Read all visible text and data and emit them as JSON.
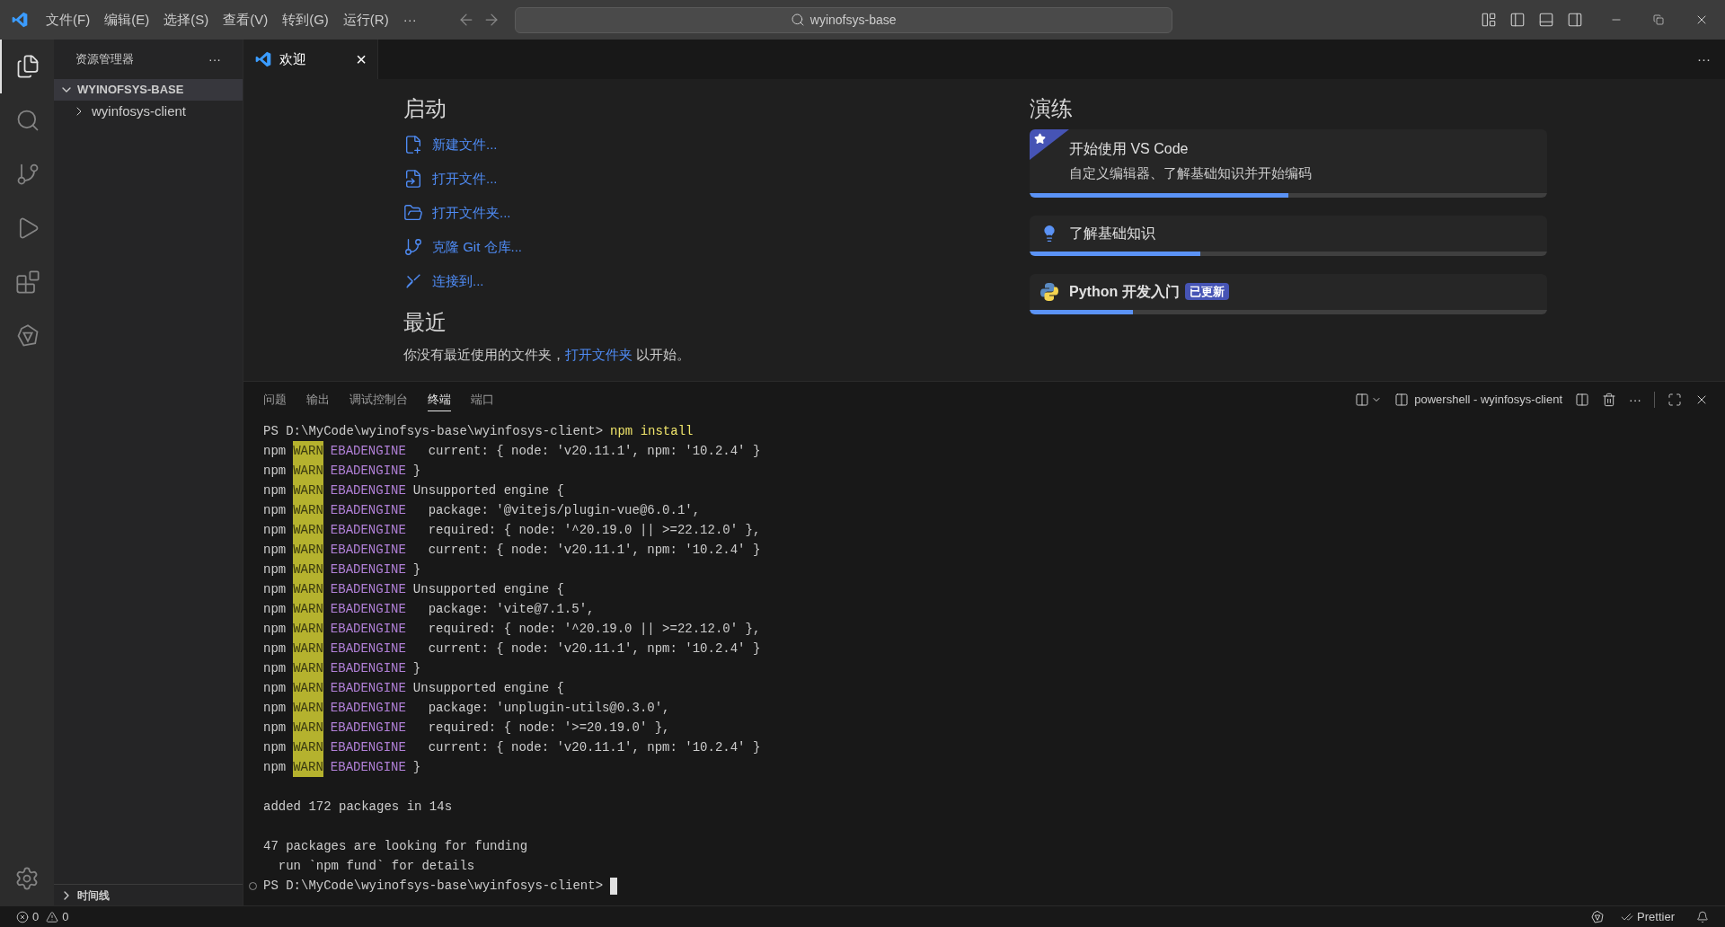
{
  "title_bar": {
    "menus": [
      "文件(F)",
      "编辑(E)",
      "选择(S)",
      "查看(V)",
      "转到(G)",
      "运行(R)",
      "···"
    ],
    "search": "wyinofsys-base"
  },
  "activity_bar": [
    {
      "kind": "files",
      "selected": true
    },
    {
      "kind": "search",
      "selected": false
    },
    {
      "kind": "git",
      "selected": false
    },
    {
      "kind": "debug",
      "selected": false
    },
    {
      "kind": "extensions",
      "selected": false
    },
    {
      "kind": "remote",
      "selected": false
    }
  ],
  "sidebar": {
    "title": "资源管理器",
    "more": "···",
    "folder": {
      "name": "WYINOFSYS-BASE",
      "expanded": true,
      "children": [
        {
          "name": "wyinfosys-client",
          "expanded": false
        }
      ]
    },
    "timeline": {
      "name": "时间线",
      "expanded": false
    }
  },
  "editor_tabs": [
    {
      "label": "欢迎",
      "selected": true,
      "close": "×"
    }
  ],
  "editor_more": "···",
  "welcome": {
    "start_title": "启动",
    "start_items": [
      {
        "kind": "new-file",
        "label": "新建文件..."
      },
      {
        "kind": "open-file",
        "label": "打开文件..."
      },
      {
        "kind": "open-folder",
        "label": "打开文件夹..."
      },
      {
        "kind": "clone",
        "label": "克隆 Git 仓库..."
      },
      {
        "kind": "connect",
        "label": "连接到..."
      }
    ],
    "recent_title": "最近",
    "recent_before": "你没有最近使用的文件夹，",
    "recent_link": "打开文件夹",
    "recent_after": "以开始。",
    "walkthrough_title": "演练",
    "walkthroughs": [
      {
        "kind": "featured",
        "title": "开始使用 VS Code",
        "description": "自定义编辑器、了解基础知识并开始编码",
        "level": 0.5
      },
      {
        "kind": "lightbulb",
        "title": "了解基础知识",
        "level": 0.33
      },
      {
        "kind": "python",
        "title": "Python 开发入门",
        "badge": "已更新",
        "level": 0.2
      }
    ]
  },
  "panel": {
    "tabs": [
      {
        "label": "问题",
        "selected": false
      },
      {
        "label": "输出",
        "selected": false
      },
      {
        "label": "调试控制台",
        "selected": false
      },
      {
        "label": "终端",
        "selected": true
      },
      {
        "label": "端口",
        "selected": false
      }
    ],
    "terminal_name": "powershell - wyinfosys-client",
    "actions_more": "···",
    "lines": [
      {
        "kind": "prompt",
        "path": "PS D:\\MyCode\\wyinofsys-base\\wyinfosys-client>",
        "command": "npm install"
      },
      {
        "kind": "warn",
        "npm": "npm",
        "level": "WARN",
        "code": "EBADENGINE",
        "text": "  current: { node: 'v20.11.1', npm: '10.2.4' }"
      },
      {
        "kind": "warn",
        "npm": "npm",
        "level": "WARN",
        "code": "EBADENGINE",
        "text": "}"
      },
      {
        "kind": "warn",
        "npm": "npm",
        "level": "WARN",
        "code": "EBADENGINE",
        "text": "Unsupported engine {"
      },
      {
        "kind": "warn",
        "npm": "npm",
        "level": "WARN",
        "code": "EBADENGINE",
        "text": "  package: '@vitejs/plugin-vue@6.0.1',"
      },
      {
        "kind": "warn",
        "npm": "npm",
        "level": "WARN",
        "code": "EBADENGINE",
        "text": "  required: { node: '^20.19.0 || >=22.12.0' },"
      },
      {
        "kind": "warn",
        "npm": "npm",
        "level": "WARN",
        "code": "EBADENGINE",
        "text": "  current: { node: 'v20.11.1', npm: '10.2.4' }"
      },
      {
        "kind": "warn",
        "npm": "npm",
        "level": "WARN",
        "code": "EBADENGINE",
        "text": "}"
      },
      {
        "kind": "warn",
        "npm": "npm",
        "level": "WARN",
        "code": "EBADENGINE",
        "text": "Unsupported engine {"
      },
      {
        "kind": "warn",
        "npm": "npm",
        "level": "WARN",
        "code": "EBADENGINE",
        "text": "  package: 'vite@7.1.5',"
      },
      {
        "kind": "warn",
        "npm": "npm",
        "level": "WARN",
        "code": "EBADENGINE",
        "text": "  required: { node: '^20.19.0 || >=22.12.0' },"
      },
      {
        "kind": "warn",
        "npm": "npm",
        "level": "WARN",
        "code": "EBADENGINE",
        "text": "  current: { node: 'v20.11.1', npm: '10.2.4' }"
      },
      {
        "kind": "warn",
        "npm": "npm",
        "level": "WARN",
        "code": "EBADENGINE",
        "text": "}"
      },
      {
        "kind": "warn",
        "npm": "npm",
        "level": "WARN",
        "code": "EBADENGINE",
        "text": "Unsupported engine {"
      },
      {
        "kind": "warn",
        "npm": "npm",
        "level": "WARN",
        "code": "EBADENGINE",
        "text": "  package: 'unplugin-utils@0.3.0',"
      },
      {
        "kind": "warn",
        "npm": "npm",
        "level": "WARN",
        "code": "EBADENGINE",
        "text": "  required: { node: '>=20.19.0' },"
      },
      {
        "kind": "warn",
        "npm": "npm",
        "level": "WARN",
        "code": "EBADENGINE",
        "text": "  current: { node: 'v20.11.1', npm: '10.2.4' }"
      },
      {
        "kind": "warn",
        "npm": "npm",
        "level": "WARN",
        "code": "EBADENGINE",
        "text": "}"
      },
      {
        "kind": "blank"
      },
      {
        "kind": "plain",
        "text": "added 172 packages in 14s"
      },
      {
        "kind": "blank"
      },
      {
        "kind": "plain",
        "text": "47 packages are looking for funding"
      },
      {
        "kind": "plain",
        "text": "  run `npm fund` for details"
      },
      {
        "kind": "prompt",
        "path": "PS D:\\MyCode\\wyinofsys-base\\wyinfosys-client>",
        "cursor": true
      }
    ]
  },
  "status_bar": {
    "errors": "0",
    "warnings": "0",
    "formatter": "Prettier"
  }
}
